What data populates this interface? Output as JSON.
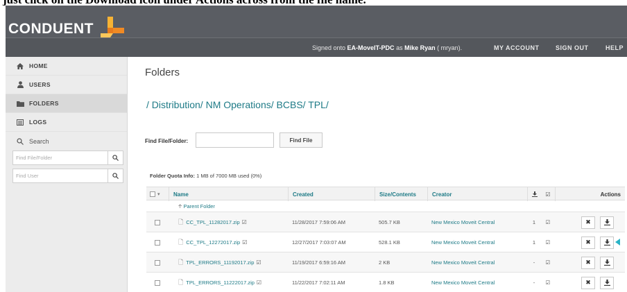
{
  "document": {
    "caption": "just click on the Download icon under Actions across from the file name."
  },
  "header": {
    "logo_text": "CONDUENT",
    "signed_prefix": "Signed onto ",
    "signed_host": "EA-MoveIT-PDC",
    "signed_mid": " as ",
    "signed_user": "Mike Ryan",
    "signed_suffix": " ( mryan).",
    "my_account": "MY ACCOUNT",
    "sign_out": "SIGN OUT",
    "help": "HELP"
  },
  "sidebar": {
    "items": [
      {
        "label": "HOME",
        "icon": "home-icon"
      },
      {
        "label": "USERS",
        "icon": "user-icon"
      },
      {
        "label": "FOLDERS",
        "icon": "folder-icon"
      },
      {
        "label": "LOGS",
        "icon": "logs-icon"
      }
    ],
    "search_label": "Search",
    "find_folder_placeholder": "Find File/Folder",
    "find_user_placeholder": "Find User"
  },
  "main": {
    "title": "Folders",
    "breadcrumb": [
      "/ Distribution/",
      "NM Operations/",
      "BCBS/",
      "TPL/"
    ],
    "find_label": "Find File/Folder:",
    "find_value": "",
    "find_button": "Find File",
    "quota_label": "Folder Quota Info:",
    "quota_value": "1 MB of 7000 MB used (0%)"
  },
  "table": {
    "columns": {
      "name": "Name",
      "created": "Created",
      "size": "Size/Contents",
      "creator": "Creator",
      "actions": "Actions"
    },
    "parent_folder": "Parent Folder",
    "rows": [
      {
        "name": "CC_TPL_11282017.zip",
        "created": "11/28/2017 7:59:06 AM",
        "size": "505.7 KB",
        "creator": "New Mexico Moveit Central",
        "downloads": "1"
      },
      {
        "name": "CC_TPL_12272017.zip",
        "created": "12/27/2017 7:03:07 AM",
        "size": "528.1 KB",
        "creator": "New Mexico Moveit Central",
        "downloads": "1"
      },
      {
        "name": "TPL_ERRORS_11192017.zip",
        "created": "11/19/2017 6:59:16 AM",
        "size": "2 KB",
        "creator": "New Mexico Moveit Central",
        "downloads": "-"
      },
      {
        "name": "TPL_ERRORS_11222017.zip",
        "created": "11/22/2017 7:02:11 AM",
        "size": "1.8 KB",
        "creator": "New Mexico Moveit Central",
        "downloads": "-"
      }
    ]
  },
  "colors": {
    "topbar": "#5a5d63",
    "accent_teal": "#1d7a86",
    "logo_orange": "#f5a623",
    "marker": "#2ab3c6"
  }
}
